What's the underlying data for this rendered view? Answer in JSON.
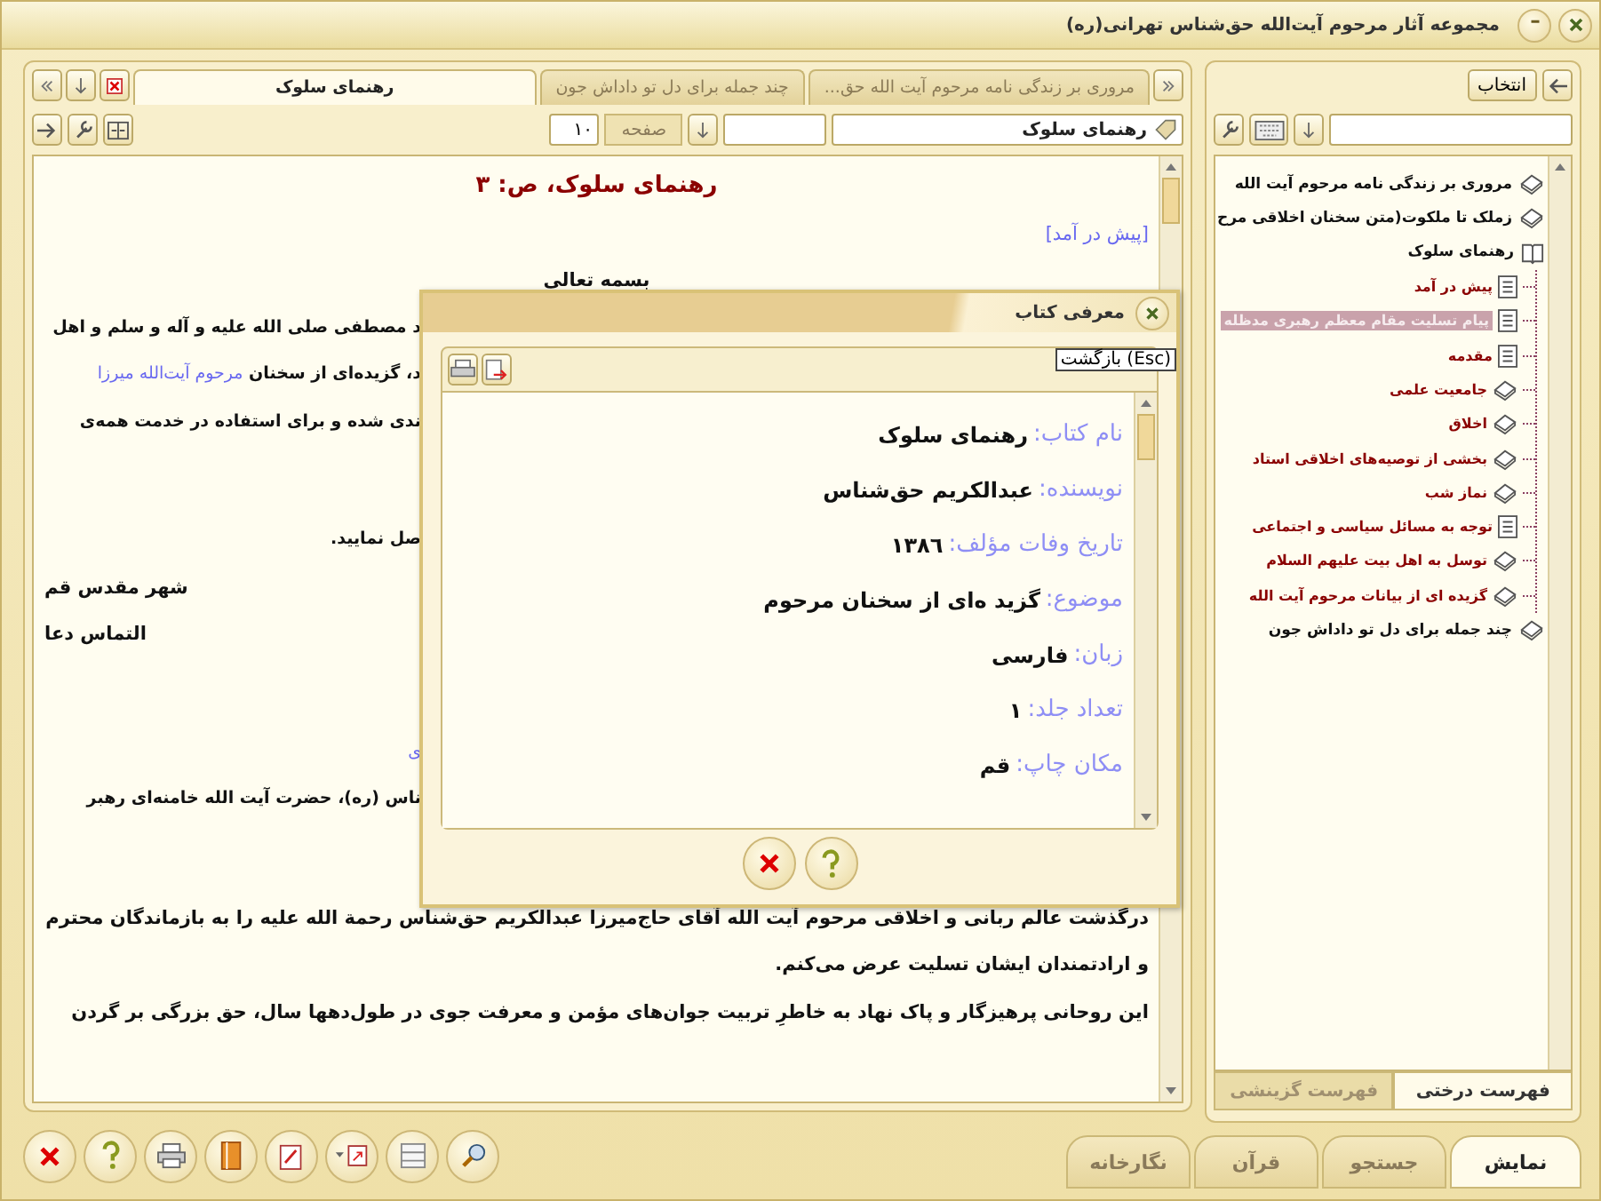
{
  "window": {
    "title": "مجموعه آثار مرحوم آیت‌الله حق‌شناس تهرانی(ره)"
  },
  "doc_tabs": [
    {
      "label": "مروری بر زندگی نامه مرحوم آیت الله حق...",
      "selected": false
    },
    {
      "label": "چند جمله برای دل تو داداش جون",
      "selected": false
    },
    {
      "label": "رهنمای سلوک",
      "selected": true
    }
  ],
  "doc_toolbar": {
    "title_field": "رهنمای سلوک",
    "page_label": "صفحه",
    "page_field": "۱۰"
  },
  "document": {
    "paragraphs": [
      {
        "lines": [
          {
            "kind": "heading",
            "text": "رهنمای سلوک، ص: ۳"
          },
          {
            "kind": "link",
            "text": "[پیش در آمد]"
          },
          {
            "kind": "center",
            "text": "بسمه تعالی"
          },
          {
            "kind": "tail",
            "text": "د مصطفی صلی الله علیه و آله و سلم و اهل"
          },
          {
            "kind": "tail",
            "text": "د، گزیده‌ای از سخنان ",
            "link": "مرحوم آیت‌الله میرزا"
          },
          {
            "kind": "tail",
            "text": "ندی شده و برای استفاده در خدمت همه‌ی"
          }
        ]
      },
      {
        "lines": [
          {
            "kind": "tail",
            "text": "صل نمایید."
          },
          {
            "kind": "left",
            "text": "شهر مقدس قم"
          },
          {
            "kind": "left",
            "text": "التماس دعا"
          }
        ]
      },
      {
        "lines": [
          {
            "kind": "tail",
            "link": "ی"
          },
          {
            "kind": "tail",
            "text": "ناس (ره)، حضرت آیت الله خامنه‌ای رهبر"
          }
        ]
      },
      {
        "lines": [
          {
            "kind": "text",
            "text": "درگذشت عالم ربانی و اخلاقی مرحوم آیت الله آقای حاج‌میرزا عبدالکریم حق‌شناس رحمة الله علیه را به بازماندگان محترم"
          },
          {
            "kind": "text",
            "text": "و ارادتمندان ایشان تسلیت عرض می‌کنم."
          },
          {
            "kind": "text",
            "text": "این روحانی پرهیزگار و پاک نهاد به خاطرِ تربیت جوان‌های مؤمن و معرفت جوی در طول‌دهها سال، حق بزرگی بر گردن"
          }
        ]
      }
    ]
  },
  "sidebar": {
    "button": "انتخاب",
    "tree": [
      {
        "label": "مروری بر زندگی نامه مرحوم آیت الله",
        "selected": false,
        "expanded": false
      },
      {
        "label": "زملک تا ملکوت(متن سخنان اخلاقی مرح",
        "selected": false,
        "expanded": false
      },
      {
        "label": "رهنمای سلوک",
        "selected": false,
        "expanded": true,
        "children": [
          {
            "label": "پیش در آمد",
            "kind": "page",
            "selected": false
          },
          {
            "label": "پیام تسلیت مقام معظم رهبری مدظله",
            "kind": "page",
            "selected": true
          },
          {
            "label": "مقدمه",
            "kind": "page",
            "selected": false
          },
          {
            "label": "جامعیت علمی",
            "kind": "book",
            "selected": false
          },
          {
            "label": "اخلاق",
            "kind": "book",
            "selected": false
          },
          {
            "label": "بخشی از توصیه‌های اخلاقی استاد",
            "kind": "book",
            "selected": false
          },
          {
            "label": "نماز شب",
            "kind": "book",
            "selected": false
          },
          {
            "label": "توجه به مسائل سیاسی و اجتماعی",
            "kind": "page",
            "selected": false
          },
          {
            "label": "توسل به اهل بیت علیهم السلام",
            "kind": "book",
            "selected": false
          },
          {
            "label": "گزیده ای از بیانات مرحوم آیت الله",
            "kind": "book",
            "selected": false
          }
        ]
      },
      {
        "label": "چند جمله برای دل تو داداش جون",
        "selected": false,
        "expanded": false
      }
    ],
    "tabs": [
      {
        "label": "فهرست درختی",
        "selected": true
      },
      {
        "label": "فهرست گزینشی",
        "selected": false
      }
    ]
  },
  "dialog": {
    "title": "معرفی کتاب",
    "tooltip": "بازگشت (Esc)",
    "fields": [
      {
        "label": "نام کتاب:",
        "value": "رهنمای سلوک"
      },
      {
        "label": "نویسنده:",
        "value": "عبدالکریم حق‌شناس"
      },
      {
        "label": "تاریخ وفات مؤلف:",
        "value": "١٣٨٦"
      },
      {
        "label": "موضوع:",
        "value": "گزید ه‌ای از سخنان مرحوم"
      },
      {
        "label": "زبان:",
        "value": "فارسی"
      },
      {
        "label": "تعداد جلد:",
        "value": "١"
      },
      {
        "label": "مکان چاپ:",
        "value": "قم"
      }
    ]
  },
  "bottom_tabs": [
    {
      "label": "نمایش",
      "selected": true
    },
    {
      "label": "جستجو",
      "selected": false
    },
    {
      "label": "قرآن",
      "selected": false
    },
    {
      "label": "نگارخانه",
      "selected": false
    }
  ]
}
